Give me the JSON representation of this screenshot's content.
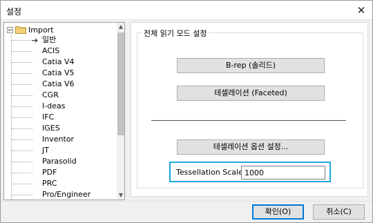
{
  "window": {
    "title": "설정"
  },
  "tree": {
    "root_label": "Import",
    "items": [
      {
        "label": "일반",
        "selected": true
      },
      {
        "label": "ACIS"
      },
      {
        "label": "Catia V4"
      },
      {
        "label": "Catia V5"
      },
      {
        "label": "Catia V6"
      },
      {
        "label": "CGR"
      },
      {
        "label": "I-deas"
      },
      {
        "label": "IFC"
      },
      {
        "label": "IGES"
      },
      {
        "label": "Inventor"
      },
      {
        "label": "JT"
      },
      {
        "label": "Parasolid"
      },
      {
        "label": "PDF"
      },
      {
        "label": "PRC"
      },
      {
        "label": "Pro/Engineer"
      }
    ]
  },
  "panel": {
    "group_title": "전체 읽기 모드 설정",
    "brep_button": "B-rep (솔리드)",
    "faceted_button": "테셀레이션 (Faceted)",
    "tess_options_button": "테셀레이션 옵션 설정...",
    "tess_scale_label": "Tessellation Scale",
    "tess_scale_value": "1000"
  },
  "footer": {
    "ok_label": "확인(O)",
    "cancel_label": "취소(C)"
  },
  "colors": {
    "focus_border": "#1ea6dc",
    "default_button_border": "#0078d7"
  },
  "icons": {
    "close": "close-icon",
    "folder": "folder-icon",
    "arrow": "arrow-right-icon"
  }
}
